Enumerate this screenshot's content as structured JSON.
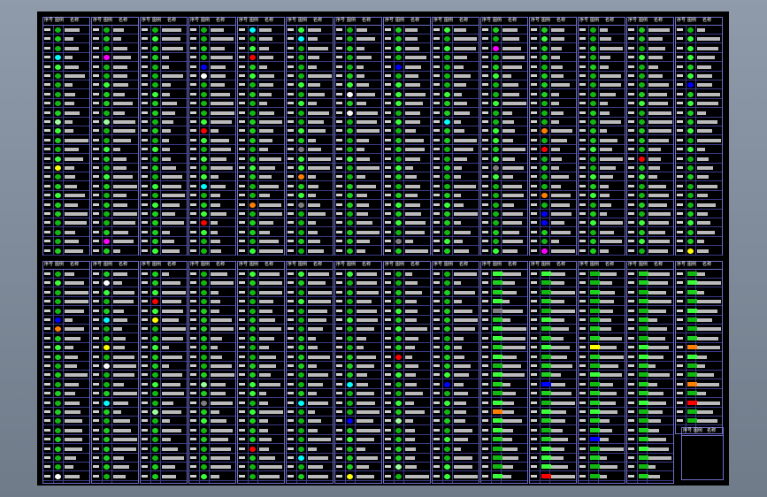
{
  "window": {
    "title": ""
  },
  "legend": {
    "header": {
      "seq": "序号",
      "icon": "图例",
      "name": "名称"
    }
  },
  "colors": {
    "frame": "#6e6ec8",
    "background": "#000000",
    "symbol_palette": [
      "#1fd11f",
      "#11b811",
      "#3bff3b",
      "#ff00ff",
      "#ff8000",
      "#ffff00",
      "#ff0000",
      "#00ffff",
      "#0000ff",
      "#7f7f7f",
      "#ffffff",
      "#9fff9f"
    ]
  }
}
